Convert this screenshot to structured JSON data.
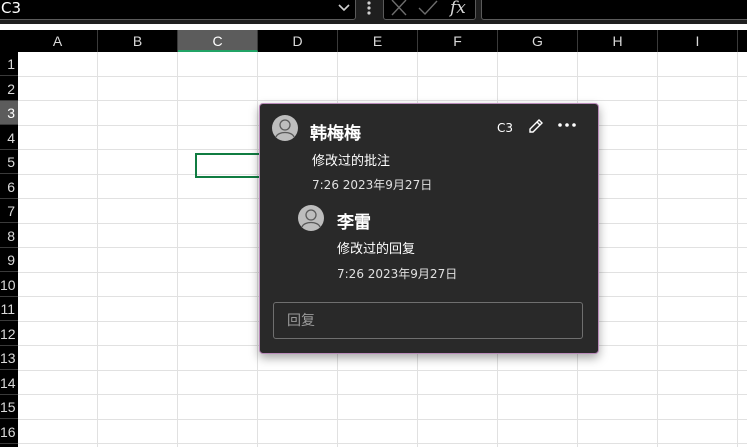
{
  "formula_bar": {
    "name_box": "C3",
    "chevron_icon": "chevron-down-icon",
    "cancel_icon": "close-icon",
    "enter_icon": "check-icon",
    "function_label": "fx",
    "formula_value": ""
  },
  "columns": [
    "A",
    "B",
    "C",
    "D",
    "E",
    "F",
    "G",
    "H",
    "I"
  ],
  "active_column": "C",
  "rows": [
    "1",
    "2",
    "3",
    "4",
    "5",
    "6",
    "7",
    "8",
    "9",
    "10",
    "11",
    "12",
    "13",
    "14",
    "15",
    "16"
  ],
  "active_row": "3",
  "comment": {
    "cell_ref": "C3",
    "author": "韩梅梅",
    "text": "修改过的批注",
    "time": "7:26 2023年9月27日",
    "marker_color": "#a64ca6",
    "reply": {
      "author": "李雷",
      "text": "修改过的回复",
      "time": "7:26 2023年9月27日"
    },
    "reply_placeholder": "回复"
  }
}
